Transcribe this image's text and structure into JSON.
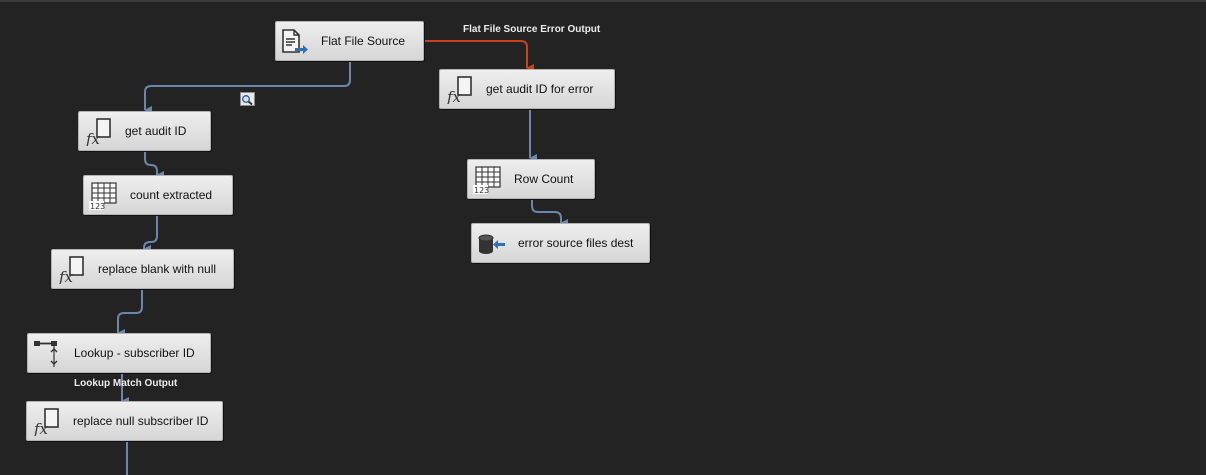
{
  "colors": {
    "canvas": "#232323",
    "path": "#6a86aa",
    "error_path": "#c8421b",
    "node_text": "#111111"
  },
  "path_labels": {
    "error_output": "Flat File Source Error Output",
    "lookup_match_output": "Lookup Match Output"
  },
  "nodes": {
    "flat_file_source": {
      "label": "Flat File Source",
      "icon": "flat-file-source-icon"
    },
    "get_audit_id": {
      "label": "get audit ID",
      "icon": "derived-column-icon"
    },
    "count_extracted": {
      "label": "count extracted",
      "icon": "row-count-icon"
    },
    "replace_blank_with_null": {
      "label": "replace blank with null",
      "icon": "derived-column-icon"
    },
    "lookup_subscriber_id": {
      "label": "Lookup - subscriber ID",
      "icon": "lookup-icon"
    },
    "replace_null_subscriber_id": {
      "label": "replace null subscriber ID",
      "icon": "derived-column-icon"
    },
    "get_audit_id_for_error": {
      "label": "get audit ID for error",
      "icon": "derived-column-icon"
    },
    "row_count": {
      "label": "Row Count",
      "icon": "row-count-icon"
    },
    "error_source_files_dest": {
      "label": "error source files dest",
      "icon": "destination-icon"
    }
  },
  "data_viewer_icon": "magnifier-icon"
}
